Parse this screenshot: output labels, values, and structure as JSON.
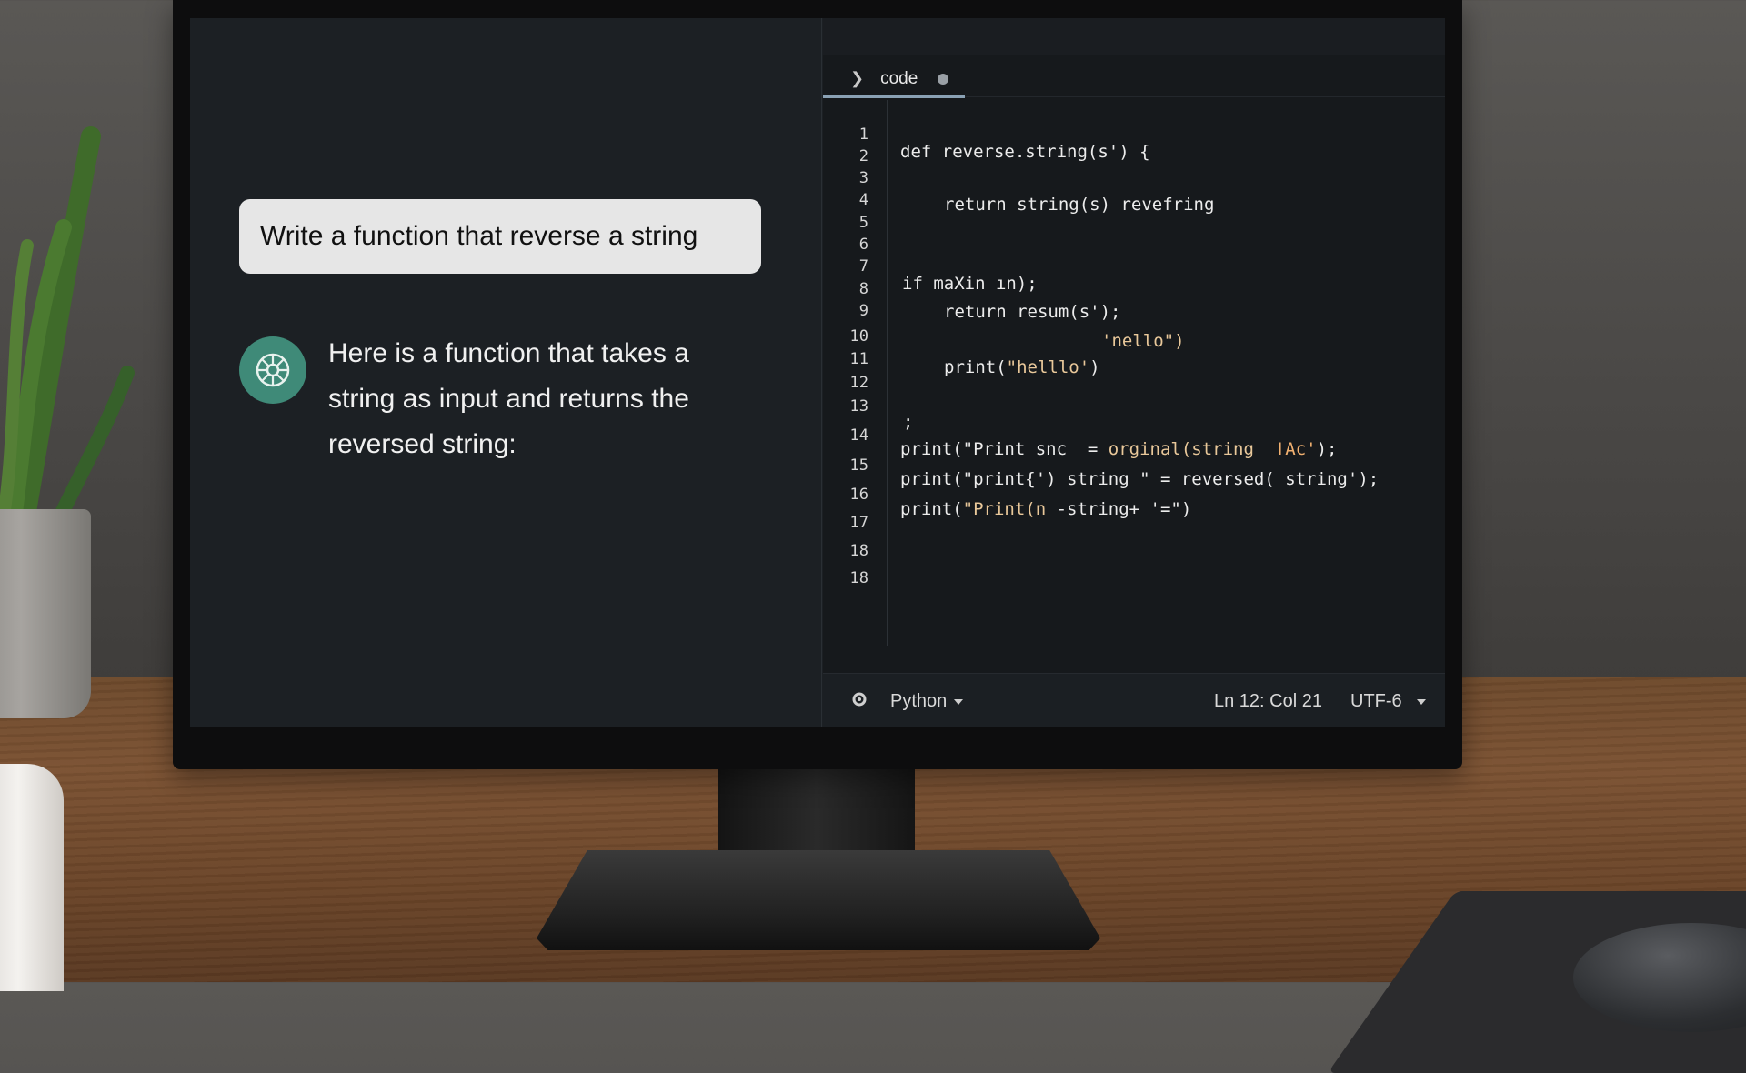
{
  "chat": {
    "user_prompt": "Write a function that reverse a string",
    "assistant_reply": "Here is a function that takes a string as input and returns the reversed string:"
  },
  "editor": {
    "tab_label": "code",
    "line_numbers": [
      "1",
      "2",
      "3",
      "4",
      "5",
      "6",
      "7",
      "8",
      "9",
      "10",
      "11",
      "12",
      "13",
      "14",
      "15",
      "16",
      "17",
      "18",
      "18"
    ],
    "lines": {
      "l2": "def reverse.string(s') {",
      "l4": "return string(s) revefring",
      "l7": "if maXin ın);",
      "l8": "return resum(s');",
      "l9": "'nello\")",
      "l10a": "print(",
      "l10b": "\"helllo'",
      "l10c": ")",
      "l12": ";",
      "l13a": "print(\"Print snc  = ",
      "l13b": "orginal(string  ",
      "l13c": "ǀAc'",
      "l13d": ");",
      "l14": "print(\"print{') string \" = reversed( string');",
      "l15a": "print(",
      "l15b": "\"Print(n ",
      "l15c": "-string+ '=\")"
    },
    "status": {
      "language": "Python",
      "cursor": "Ln 12:  Col 21",
      "encoding": "UTF-6"
    }
  }
}
